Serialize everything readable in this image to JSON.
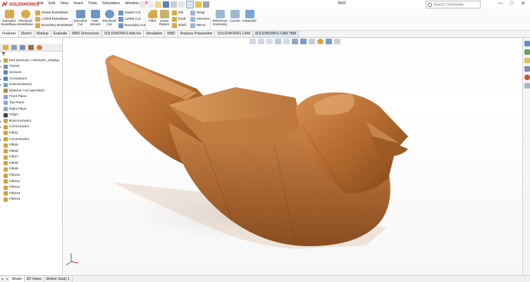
{
  "app": {
    "logo_text": "SOLIDWORKS",
    "document_title": "bird"
  },
  "menu": [
    "File",
    "Edit",
    "View",
    "Insert",
    "Tools",
    "Simulation",
    "Window"
  ],
  "search": {
    "placeholder": "Search Commands"
  },
  "window_buttons": {
    "minimize": "—",
    "maximize": "□",
    "close": "✕"
  },
  "ribbon": {
    "extruded_boss": "Extruded\nBoss/Base",
    "revolved_boss": "Revolved\nBoss/Base",
    "swept_boss": "Swept Boss/Base",
    "lofted_boss": "Lofted Boss/Base",
    "boundary_boss": "Boundary Boss/Base",
    "extruded_cut": "Extruded\nCut",
    "hole_wizard": "Hole\nWizard",
    "revolved_cut": "Revolved\nCut",
    "swept_cut": "Swept Cut",
    "lofted_cut": "Lofted Cut",
    "boundary_cut": "Boundary Cut",
    "fillet": "Fillet",
    "linear_pattern": "Linear\nPattern",
    "rib": "Rib",
    "draft": "Draft",
    "shell": "Shell",
    "wrap": "Wrap",
    "intersect": "Intersect",
    "mirror": "Mirror",
    "reference_geometry": "Reference\nGeometry",
    "curves": "Curves",
    "instant3d": "Instant3D"
  },
  "command_tabs": [
    "Features",
    "Sketch",
    "Markup",
    "Evaluate",
    "MBD Dimensions",
    "SOLIDWORKS Add-Ins",
    "Simulation",
    "MBD",
    "Analysis Preparation",
    "SOLIDWORKS CAM",
    "SOLIDWORKS CAM TBM"
  ],
  "feature_tree": [
    {
      "label": "bird (Default) <<Default>_Display",
      "arrow": "▸",
      "icon": "part-icon",
      "color": "#c9a33b"
    },
    {
      "label": "History",
      "arrow": "▸",
      "icon": "history-icon",
      "color": "#7a8fa8"
    },
    {
      "label": "Sensors",
      "arrow": "",
      "icon": "sensor-icon",
      "color": "#5a84c0"
    },
    {
      "label": "Annotations",
      "arrow": "▸",
      "icon": "annotation-icon",
      "color": "#4f7fbf"
    },
    {
      "label": "Solid Bodies(1)",
      "arrow": "▸",
      "icon": "solid-body-icon",
      "color": "#7aa0c8"
    },
    {
      "label": "Material <not specified>",
      "arrow": "",
      "icon": "material-icon",
      "color": "#b38b4a"
    },
    {
      "label": "Front Plane",
      "arrow": "",
      "icon": "plane-icon",
      "color": "#8aa9cf"
    },
    {
      "label": "Top Plane",
      "arrow": "",
      "icon": "plane-icon",
      "color": "#8aa9cf"
    },
    {
      "label": "Right Plane",
      "arrow": "",
      "icon": "plane-icon",
      "color": "#8aa9cf"
    },
    {
      "label": "Origin",
      "arrow": "",
      "icon": "origin-icon",
      "color": "#444"
    },
    {
      "label": "Boss-Extrude1",
      "arrow": "▸",
      "icon": "extrude-icon",
      "color": "#d1a43c"
    },
    {
      "label": "Cut-Extrude1",
      "arrow": "▸",
      "icon": "cut-icon",
      "color": "#d1a43c"
    },
    {
      "label": "Fillet1",
      "arrow": "",
      "icon": "fillet-icon",
      "color": "#d1a43c"
    },
    {
      "label": "Cut-Extrude2",
      "arrow": "▸",
      "icon": "cut-icon",
      "color": "#d1a43c"
    },
    {
      "label": "Fillet5",
      "arrow": "",
      "icon": "fillet-icon",
      "color": "#d1a43c"
    },
    {
      "label": "Fillet6",
      "arrow": "",
      "icon": "fillet-icon",
      "color": "#d1a43c"
    },
    {
      "label": "Fillet7",
      "arrow": "",
      "icon": "fillet-icon",
      "color": "#d1a43c"
    },
    {
      "label": "Fillet8",
      "arrow": "",
      "icon": "fillet-icon",
      "color": "#d1a43c"
    },
    {
      "label": "Fillet9",
      "arrow": "",
      "icon": "fillet-icon",
      "color": "#d1a43c"
    },
    {
      "label": "Fillet10",
      "arrow": "",
      "icon": "fillet-icon",
      "color": "#d1a43c"
    },
    {
      "label": "Fillet11",
      "arrow": "",
      "icon": "fillet-icon",
      "color": "#d1a43c"
    },
    {
      "label": "Fillet12",
      "arrow": "",
      "icon": "fillet-icon",
      "color": "#d1a43c"
    },
    {
      "label": "Fillet13",
      "arrow": "",
      "icon": "fillet-icon",
      "color": "#d1a43c"
    },
    {
      "label": "Fillet15",
      "arrow": "",
      "icon": "fillet-icon",
      "color": "#d1a43c"
    }
  ],
  "bottom_tabs": [
    "Model",
    "3D Views",
    "Motion Study 1"
  ],
  "colors": {
    "wood_light": "#c87f42",
    "wood_mid": "#a45f28",
    "wood_dark": "#6b3a17",
    "brand_red": "#d02b1f",
    "accent_blue": "#3b6fb6"
  }
}
